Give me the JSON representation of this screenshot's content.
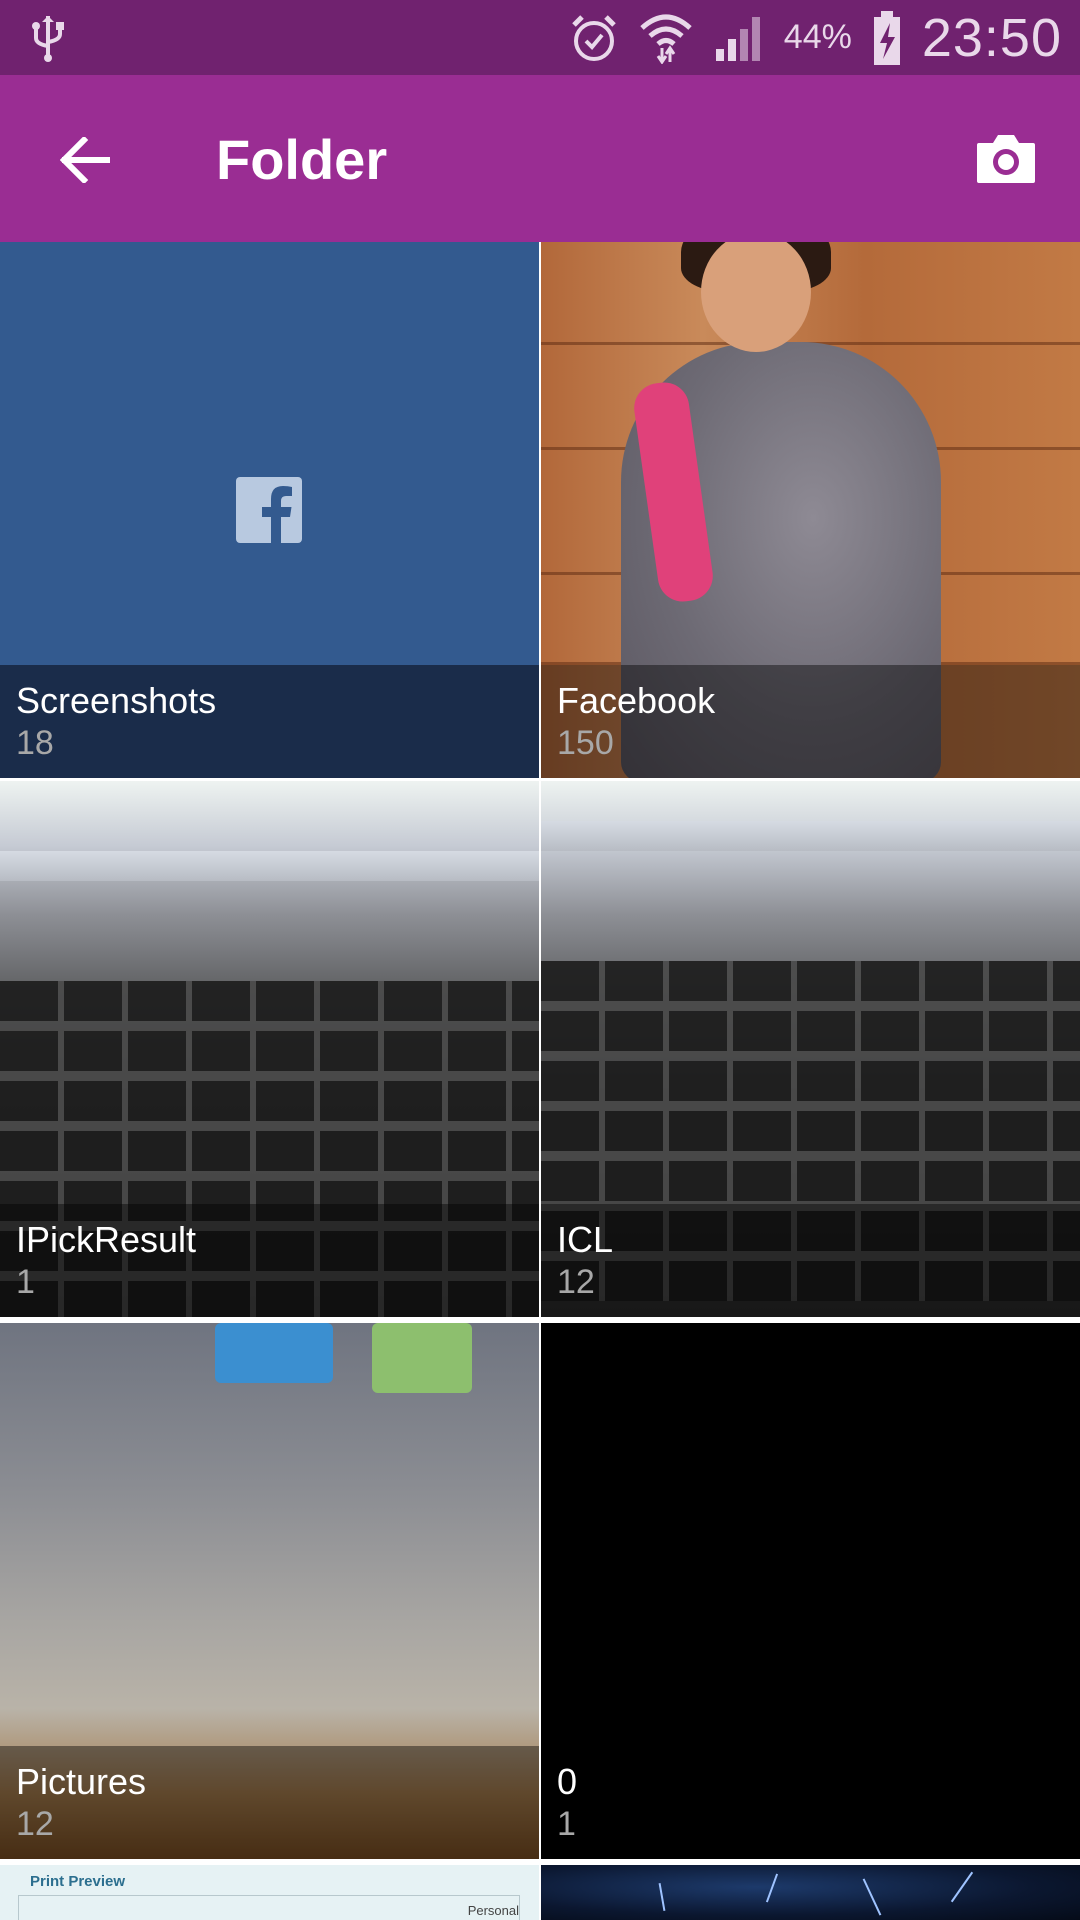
{
  "status_bar": {
    "battery_percent": "44%",
    "time": "23:50",
    "icons": [
      "usb-icon",
      "alarm-icon",
      "wifi-icon",
      "signal-icon",
      "battery-charging-icon"
    ]
  },
  "app_bar": {
    "title": "Folder",
    "back_icon": "arrow-left-icon",
    "camera_icon": "camera-icon"
  },
  "folders": [
    {
      "name": "Screenshots",
      "count": "18"
    },
    {
      "name": "Facebook",
      "count": "150"
    },
    {
      "name": "IPickResult",
      "count": "1"
    },
    {
      "name": "ICL",
      "count": "12"
    },
    {
      "name": "Pictures",
      "count": "12"
    },
    {
      "name": "0",
      "count": "1"
    }
  ],
  "partial_thumbnails": {
    "print_preview_title": "Print Preview",
    "print_preview_label": "Personal"
  },
  "colors": {
    "status_bar": "#70226f",
    "app_bar": "#9a2d93"
  }
}
